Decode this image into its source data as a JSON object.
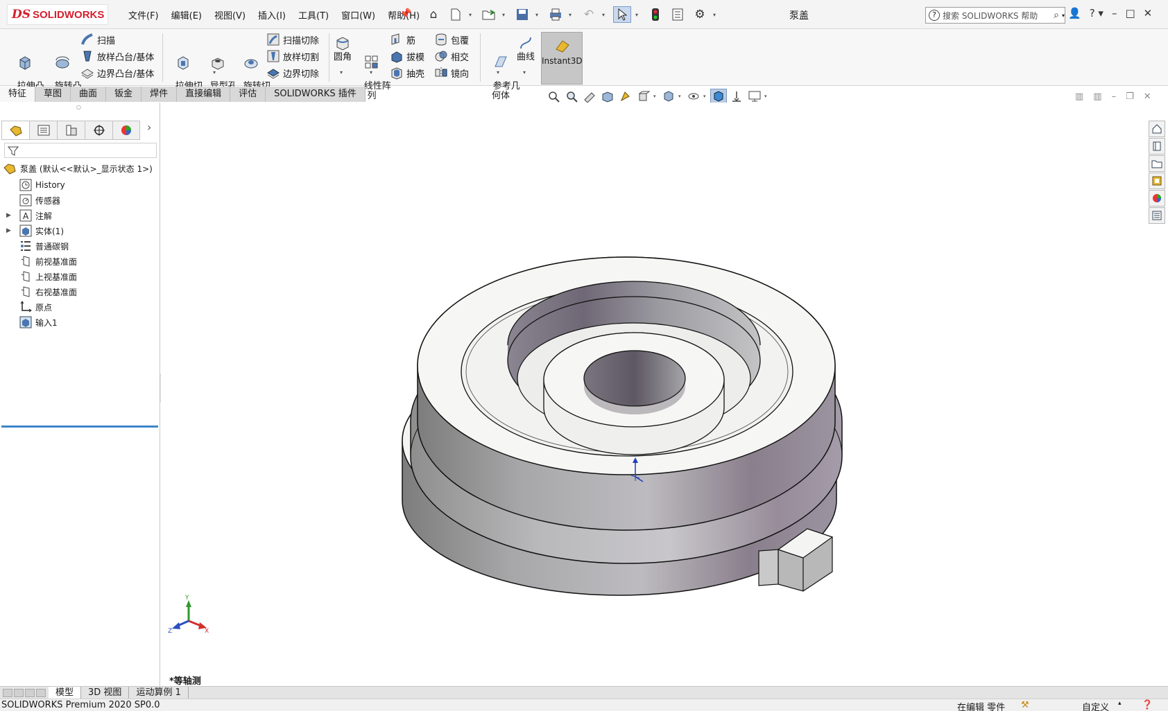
{
  "app": {
    "logo_text": "SOLIDWORKS",
    "document_title": "泵盖",
    "menu": [
      "文件(F)",
      "编辑(E)",
      "视图(V)",
      "插入(I)",
      "工具(T)",
      "窗口(W)",
      "帮助(H)"
    ],
    "search_placeholder": "搜索 SOLIDWORKS 帮助"
  },
  "ribbon": {
    "extrude_boss": "拉伸凸\n台/基体",
    "revolve_boss": "旋转凸\n台/基体",
    "sweep": "扫描",
    "loft_boss": "放样凸台/基体",
    "boundary_boss": "边界凸台/基体",
    "extrude_cut": "拉伸切\n除",
    "hole_wizard": "异型孔\n向导",
    "revolve_cut": "旋转切\n除",
    "swept_cut": "扫描切除",
    "lofted_cut": "放样切割",
    "boundary_cut": "边界切除",
    "fillet": "圆角",
    "linear_pattern": "线性阵\n列",
    "rib": "筋",
    "draft": "拔模",
    "shell": "抽壳",
    "wrap": "包覆",
    "intersect": "相交",
    "mirror": "镜向",
    "reference_geometry": "参考几\n何体",
    "curves": "曲线",
    "instant3d": "Instant3D"
  },
  "command_tabs": [
    "特征",
    "草图",
    "曲面",
    "钣金",
    "焊件",
    "直接编辑",
    "评估",
    "SOLIDWORKS 插件"
  ],
  "feature_tree": {
    "root": "泵盖  (默认<<默认>_显示状态 1>)",
    "nodes": [
      {
        "label": "History",
        "icon": "history-icon",
        "expandable": false
      },
      {
        "label": "传感器",
        "icon": "sensor-icon",
        "expandable": false
      },
      {
        "label": "注解",
        "icon": "annotation-icon",
        "expandable": true
      },
      {
        "label": "实体(1)",
        "icon": "solid-bodies-icon",
        "expandable": true
      },
      {
        "label": "普通碳钢",
        "icon": "material-icon",
        "expandable": false
      },
      {
        "label": "前视基准面",
        "icon": "plane-icon",
        "expandable": false
      },
      {
        "label": "上视基准面",
        "icon": "plane-icon",
        "expandable": false
      },
      {
        "label": "右视基准面",
        "icon": "plane-icon",
        "expandable": false
      },
      {
        "label": "原点",
        "icon": "origin-icon",
        "expandable": false
      },
      {
        "label": "输入1",
        "icon": "imported-body-icon",
        "expandable": false
      }
    ]
  },
  "viewport": {
    "view_orientation": "*等轴测",
    "triad_labels": {
      "x": "X",
      "y": "Y",
      "z": "Z"
    }
  },
  "bottom_tabs": [
    "模型",
    "3D 视图",
    "运动算例 1"
  ],
  "status": {
    "product": "SOLIDWORKS Premium 2020 SP0.0",
    "mode": "在编辑 零件",
    "units": "自定义"
  },
  "colors": {
    "brand_red": "#d4202e",
    "selection_blue": "#3c86c9",
    "instant3d_active": "#c6c6c6"
  }
}
